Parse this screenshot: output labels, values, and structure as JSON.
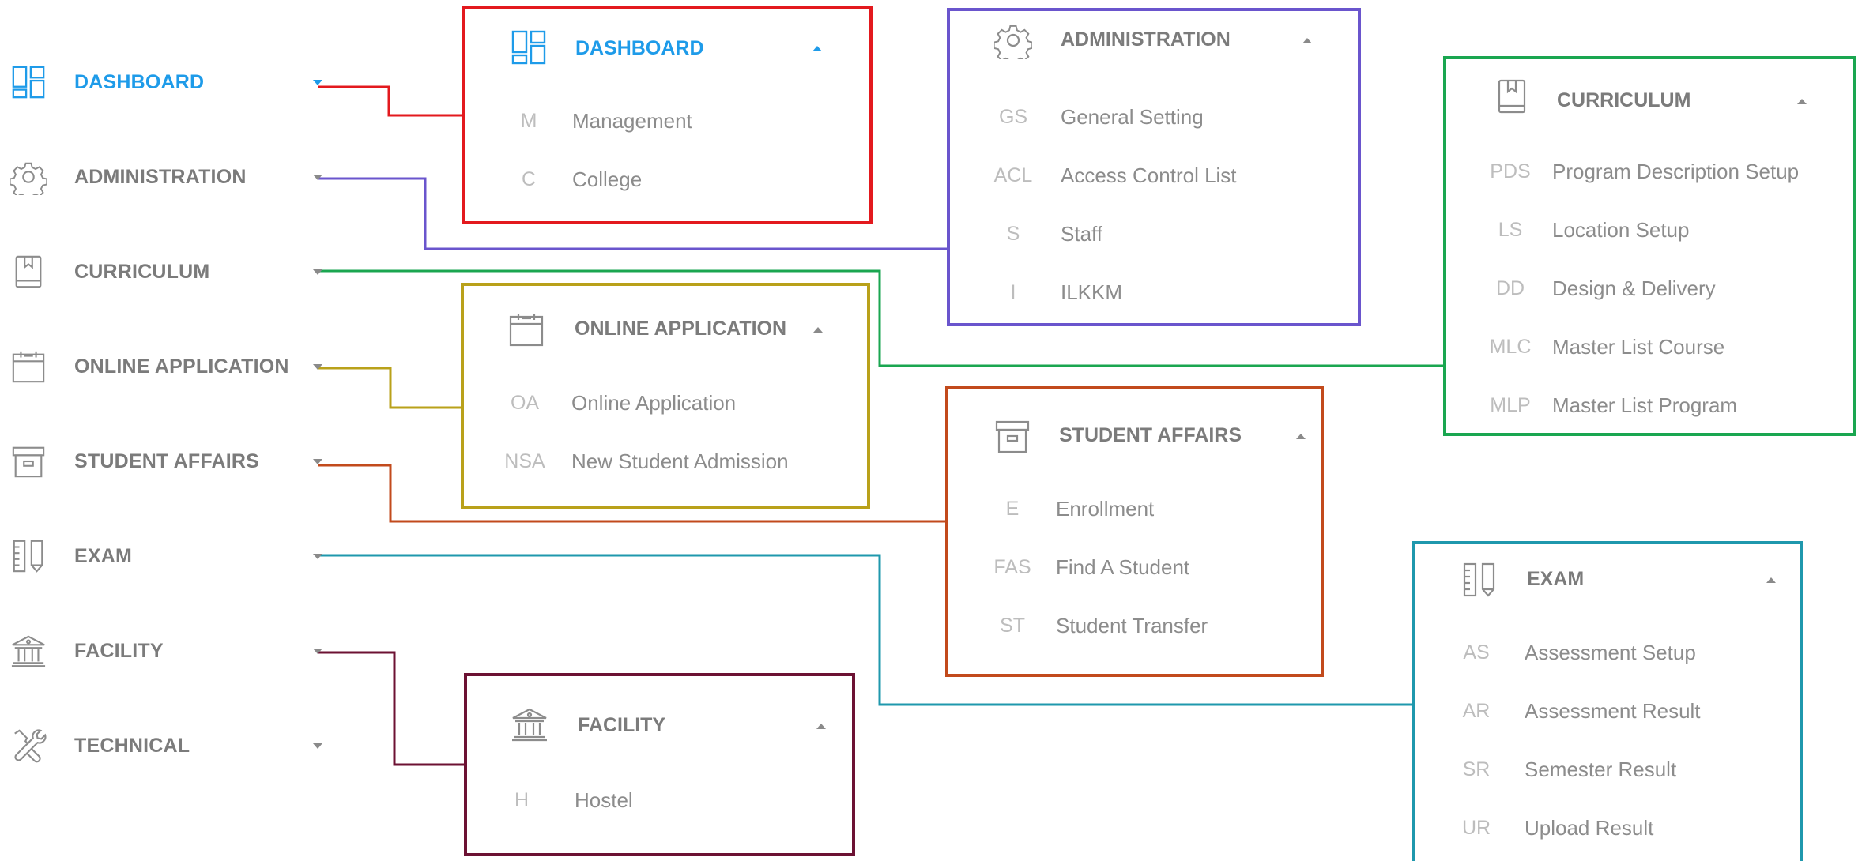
{
  "sidebar": {
    "items": [
      {
        "label": "DASHBOARD",
        "icon": "dashboard-icon",
        "active": true
      },
      {
        "label": "ADMINISTRATION",
        "icon": "gear-icon"
      },
      {
        "label": "CURRICULUM",
        "icon": "book-icon"
      },
      {
        "label": "ONLINE APPLICATION",
        "icon": "calendar-icon"
      },
      {
        "label": "STUDENT AFFAIRS",
        "icon": "archive-box-icon"
      },
      {
        "label": "EXAM",
        "icon": "ruler-pencil-icon"
      },
      {
        "label": "FACILITY",
        "icon": "building-icon"
      },
      {
        "label": "TECHNICAL",
        "icon": "tools-icon"
      }
    ]
  },
  "panels": {
    "dashboard": {
      "title": "DASHBOARD",
      "icon": "dashboard-icon",
      "items": [
        {
          "abbr": "M",
          "label": "Management"
        },
        {
          "abbr": "C",
          "label": "College"
        }
      ]
    },
    "administration": {
      "title": "ADMINISTRATION",
      "icon": "gear-icon",
      "items": [
        {
          "abbr": "GS",
          "label": "General Setting"
        },
        {
          "abbr": "ACL",
          "label": "Access Control List"
        },
        {
          "abbr": "S",
          "label": "Staff"
        },
        {
          "abbr": "I",
          "label": "ILKKM"
        }
      ]
    },
    "curriculum": {
      "title": "CURRICULUM",
      "icon": "book-icon",
      "items": [
        {
          "abbr": "PDS",
          "label": "Program Description Setup"
        },
        {
          "abbr": "LS",
          "label": "Location Setup"
        },
        {
          "abbr": "DD",
          "label": "Design & Delivery"
        },
        {
          "abbr": "MLC",
          "label": "Master List Course"
        },
        {
          "abbr": "MLP",
          "label": "Master List Program"
        }
      ]
    },
    "online_application": {
      "title": "ONLINE APPLICATION",
      "icon": "calendar-icon",
      "items": [
        {
          "abbr": "OA",
          "label": "Online Application"
        },
        {
          "abbr": "NSA",
          "label": "New Student Admission"
        }
      ]
    },
    "student_affairs": {
      "title": "STUDENT AFFAIRS",
      "icon": "archive-box-icon",
      "items": [
        {
          "abbr": "E",
          "label": "Enrollment"
        },
        {
          "abbr": "FAS",
          "label": "Find A Student"
        },
        {
          "abbr": "ST",
          "label": "Student Transfer"
        }
      ]
    },
    "exam": {
      "title": "EXAM",
      "icon": "ruler-pencil-icon",
      "items": [
        {
          "abbr": "AS",
          "label": "Assessment Setup"
        },
        {
          "abbr": "AR",
          "label": "Assessment Result"
        },
        {
          "abbr": "SR",
          "label": "Semester Result"
        },
        {
          "abbr": "UR",
          "label": "Upload Result"
        }
      ]
    },
    "facility": {
      "title": "FACILITY",
      "icon": "building-icon",
      "items": [
        {
          "abbr": "H",
          "label": "Hostel"
        }
      ]
    }
  },
  "colors": {
    "active": "#1e9be9",
    "text": "#7b7b7b",
    "muted": "#bdbdbd",
    "dashboard_frame": "#e3191e",
    "administration_frame": "#6a55cd",
    "curriculum_frame": "#1aa650",
    "online_application_frame": "#b9a11a",
    "student_affairs_frame": "#c24a1c",
    "exam_frame": "#1f98ad",
    "facility_frame": "#6c1233"
  }
}
